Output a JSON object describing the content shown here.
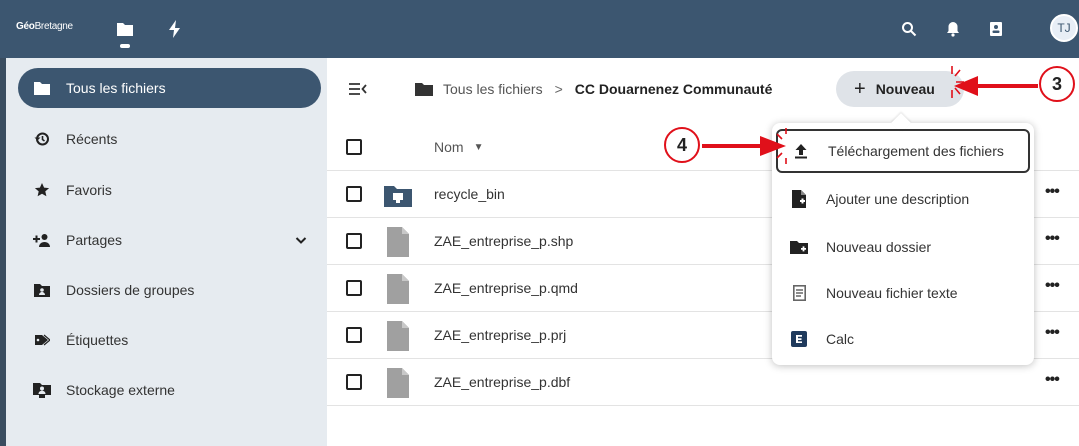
{
  "header": {
    "logo_geo": "Géo",
    "logo_rest": "Bretagne",
    "avatar_initials": "TJ"
  },
  "sidebar": {
    "items": [
      {
        "label": "Tous les fichiers",
        "icon": "folder-icon",
        "active": true
      },
      {
        "label": "Récents",
        "icon": "history-icon"
      },
      {
        "label": "Favoris",
        "icon": "star-icon"
      },
      {
        "label": "Partages",
        "icon": "share-icon",
        "expandable": true
      },
      {
        "label": "Dossiers de groupes",
        "icon": "group-folder-icon"
      },
      {
        "label": "Étiquettes",
        "icon": "tag-icon"
      },
      {
        "label": "Stockage externe",
        "icon": "external-storage-icon"
      }
    ]
  },
  "breadcrumb": {
    "root": "Tous les fichiers",
    "separator": ">",
    "current": "CC Douarnenez Communauté"
  },
  "new_button": {
    "plus": "+",
    "label": "Nouveau"
  },
  "list": {
    "column_name": "Nom",
    "sort_indicator": "▼",
    "files": [
      {
        "name": "recycle_bin",
        "type": "folder"
      },
      {
        "name": "ZAE_entreprise_p.shp",
        "type": "file"
      },
      {
        "name": "ZAE_entreprise_p.qmd",
        "type": "file"
      },
      {
        "name": "ZAE_entreprise_p.prj",
        "type": "file"
      },
      {
        "name": "ZAE_entreprise_p.dbf",
        "type": "file"
      }
    ],
    "more_label": "•••"
  },
  "menu": {
    "items": [
      {
        "label": "Téléchargement des fichiers",
        "icon": "upload-icon"
      },
      {
        "label": "Ajouter une description",
        "icon": "description-icon"
      },
      {
        "label": "Nouveau dossier",
        "icon": "new-folder-icon"
      },
      {
        "label": "Nouveau fichier texte",
        "icon": "text-file-icon"
      },
      {
        "label": "Calc",
        "icon": "calc-icon"
      }
    ]
  },
  "annotations": {
    "step3": "3",
    "step4": "4"
  },
  "colors": {
    "header": "#3c5670",
    "sidebar": "#e6ebf0",
    "annotation_red": "#e0101a"
  }
}
